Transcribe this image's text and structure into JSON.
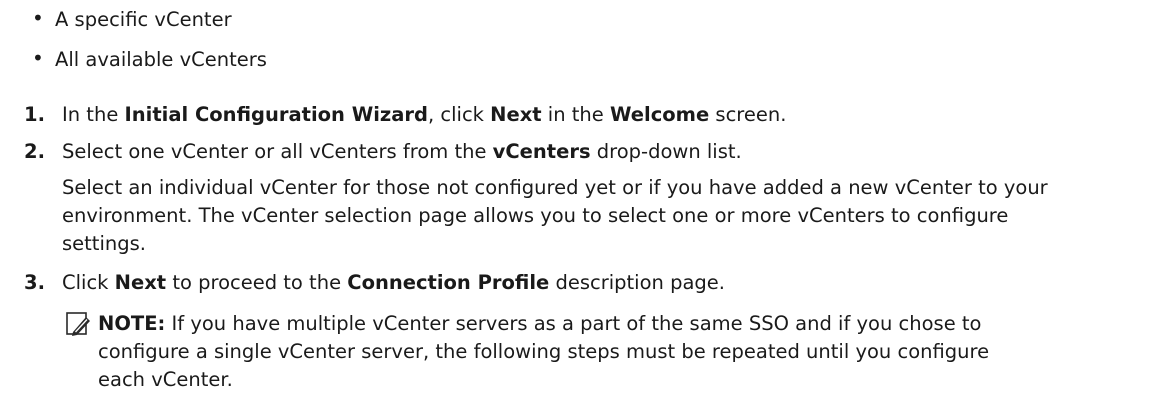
{
  "bullets": [
    {
      "text": "A specific vCenter"
    },
    {
      "text": "All available vCenters"
    }
  ],
  "steps": [
    {
      "number": "1.",
      "parts": [
        "In the ",
        "Initial Configuration Wizard",
        ", click ",
        "Next",
        " in the ",
        "Welcome",
        " screen."
      ]
    },
    {
      "number": "2.",
      "parts": [
        "Select one vCenter or all vCenters from the ",
        "vCenters",
        " drop-down list."
      ],
      "detail_lines": [
        "Select an individual vCenter for those not configured yet or if you have added a new vCenter to your",
        "environment. The vCenter selection page allows you to select one or more vCenters to configure",
        "settings."
      ]
    },
    {
      "number": "3.",
      "parts": [
        "Click ",
        "Next",
        " to proceed to the ",
        "Connection Profile",
        " description page."
      ]
    }
  ],
  "note": {
    "icon": "pencil-note-icon",
    "label": "NOTE:",
    "lines": [
      " If you have multiple vCenter servers as a part of the same SSO and if you chose to",
      "configure a single vCenter server, the following steps must be repeated until you configure",
      "each vCenter."
    ]
  }
}
